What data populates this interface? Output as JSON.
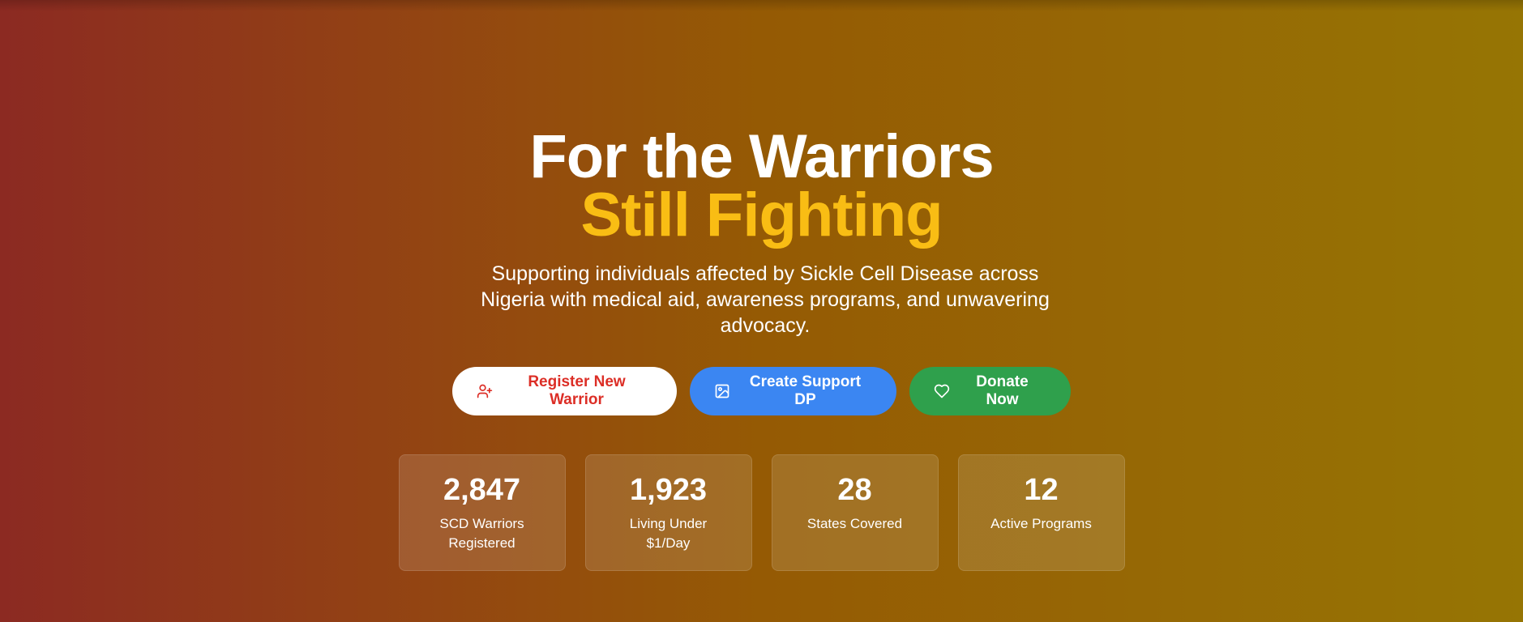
{
  "hero": {
    "title_line1": "For the Warriors",
    "title_line2": "Still Fighting",
    "subtitle": "Supporting individuals affected by Sickle Cell Disease across Nigeria with medical aid, awareness programs, and unwavering advocacy.",
    "accent_color": "#f9bd14"
  },
  "actions": {
    "register": {
      "label": "Register New Warrior",
      "icon": "user-plus-icon",
      "color": "#dc2e26"
    },
    "create_dp": {
      "label": "Create Support DP",
      "icon": "image-icon",
      "color": "#3b86f2"
    },
    "donate": {
      "label": "Donate Now",
      "icon": "heart-icon",
      "color": "#2fa04c"
    }
  },
  "stats": [
    {
      "value": "2,847",
      "label": "SCD Warriors Registered"
    },
    {
      "value": "1,923",
      "label": "Living Under $1/Day"
    },
    {
      "value": "28",
      "label": "States Covered"
    },
    {
      "value": "12",
      "label": "Active Programs"
    }
  ]
}
